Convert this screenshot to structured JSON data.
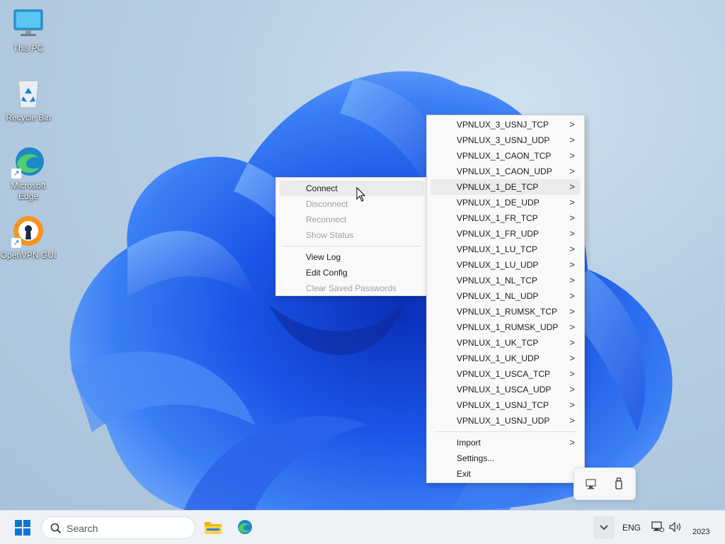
{
  "desktop": {
    "icons": [
      {
        "label": "This PC",
        "icon": "monitor-icon"
      },
      {
        "label": "Recycle Bin",
        "icon": "recycle-bin-icon"
      },
      {
        "label_line1": "Microsoft",
        "label_line2": "Edge",
        "icon": "edge-icon"
      },
      {
        "label": "OpenVPN GUI",
        "icon": "openvpn-icon"
      }
    ]
  },
  "connection_menu": {
    "items": [
      {
        "label": "Connect",
        "enabled": true
      },
      {
        "label": "Disconnect",
        "enabled": false
      },
      {
        "label": "Reconnect",
        "enabled": false
      },
      {
        "label": "Show Status",
        "enabled": false
      },
      {
        "label": "View Log",
        "enabled": true
      },
      {
        "label": "Edit Config",
        "enabled": true
      },
      {
        "label": "Clear Saved Passwords",
        "enabled": false
      }
    ]
  },
  "profile_menu": {
    "profiles": [
      "VPNLUX_3_USNJ_TCP",
      "VPNLUX_3_USNJ_UDP",
      "VPNLUX_1_CAON_TCP",
      "VPNLUX_1_CAON_UDP",
      "VPNLUX_1_DE_TCP",
      "VPNLUX_1_DE_UDP",
      "VPNLUX_1_FR_TCP",
      "VPNLUX_1_FR_UDP",
      "VPNLUX_1_LU_TCP",
      "VPNLUX_1_LU_UDP",
      "VPNLUX_1_NL_TCP",
      "VPNLUX_1_NL_UDP",
      "VPNLUX_1_RUMSK_TCP",
      "VPNLUX_1_RUMSK_UDP",
      "VPNLUX_1_UK_TCP",
      "VPNLUX_1_UK_UDP",
      "VPNLUX_1_USCA_TCP",
      "VPNLUX_1_USCA_UDP",
      "VPNLUX_1_USNJ_TCP",
      "VPNLUX_1_USNJ_UDP"
    ],
    "highlighted_profile": "VPNLUX_1_DE_TCP",
    "import_label": "Import",
    "settings_label": "Settings...",
    "exit_label": "Exit",
    "submenu_arrow": ">"
  },
  "taskbar": {
    "search_placeholder": "Search",
    "language": "ENG",
    "clock_year": "2023",
    "overflow_chevron": "chevron-up-icon"
  },
  "colors": {
    "menu_bg": "#f9f9f9",
    "hover_bg": "#ebebeb",
    "disabled_text": "#a0a0a0",
    "windows_blue": "#0078d4",
    "openvpn_orange": "#f7931e"
  }
}
